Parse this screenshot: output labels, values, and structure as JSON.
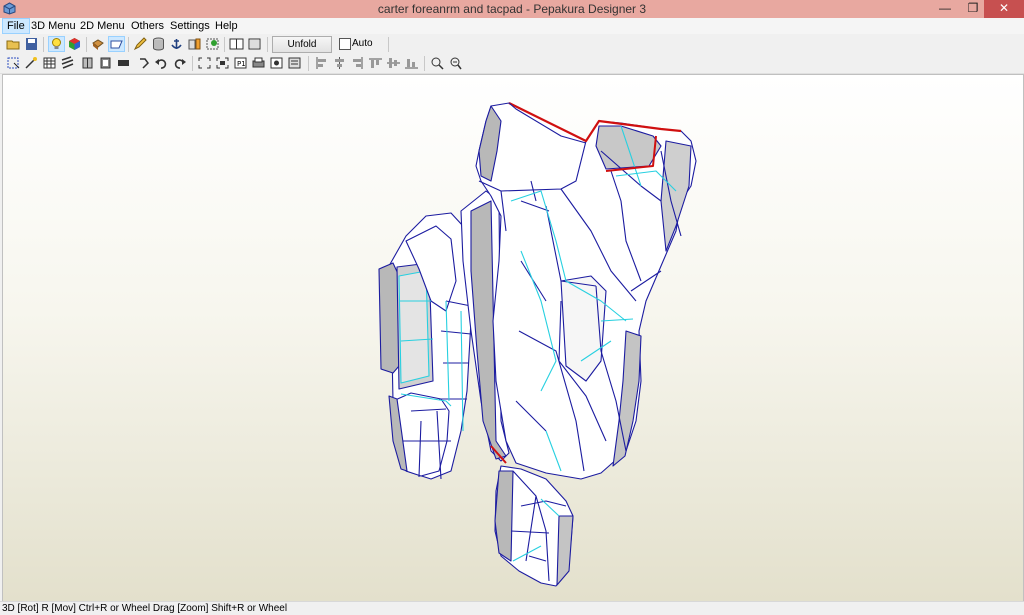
{
  "window": {
    "title": "carter foreanrm and tacpad - Pepakura Designer 3",
    "min_glyph": "—",
    "max_glyph": "❐",
    "close_glyph": "✕"
  },
  "menubar": {
    "items": [
      "File",
      "3D Menu",
      "2D Menu",
      "Others",
      "Settings",
      "Help"
    ]
  },
  "toolbar": {
    "unfold_label": "Unfold",
    "auto_label": "Auto",
    "auto_checked": false,
    "row1_icons": [
      "open-icon",
      "save-icon",
      "light-bulb-icon",
      "texture-cube-icon",
      "view-3d-icon",
      "view-mode-icon",
      "pencil-icon",
      "cylinder-icon",
      "anchor-icon",
      "flap-icon",
      "join-icon",
      "single-page-icon",
      "page-icon"
    ],
    "row2_icons": [
      "select-icon",
      "wand-icon",
      "grid-icon",
      "stripes-icon",
      "book-icon",
      "book2-icon",
      "rect-icon",
      "rotate-icon",
      "undo-icon",
      "redo-icon",
      "frame-icon",
      "frame2-icon",
      "page-number-icon",
      "print-icon",
      "export-icon",
      "text-icon",
      "align-left-icon",
      "align-center-icon",
      "align-right-icon",
      "align-top-icon",
      "align-middle-icon",
      "align-bottom-icon",
      "zoom-a-icon",
      "zoom-b-icon"
    ]
  },
  "colors": {
    "model_fill": "#ffffff",
    "model_shade": "#b8b8b8",
    "edge_blue": "#1c1ca0",
    "edge_cyan": "#27d0e0",
    "edge_red": "#d01010"
  },
  "status": {
    "text": "3D [Rot] R [Mov] Ctrl+R or Wheel Drag [Zoom] Shift+R or Wheel"
  }
}
